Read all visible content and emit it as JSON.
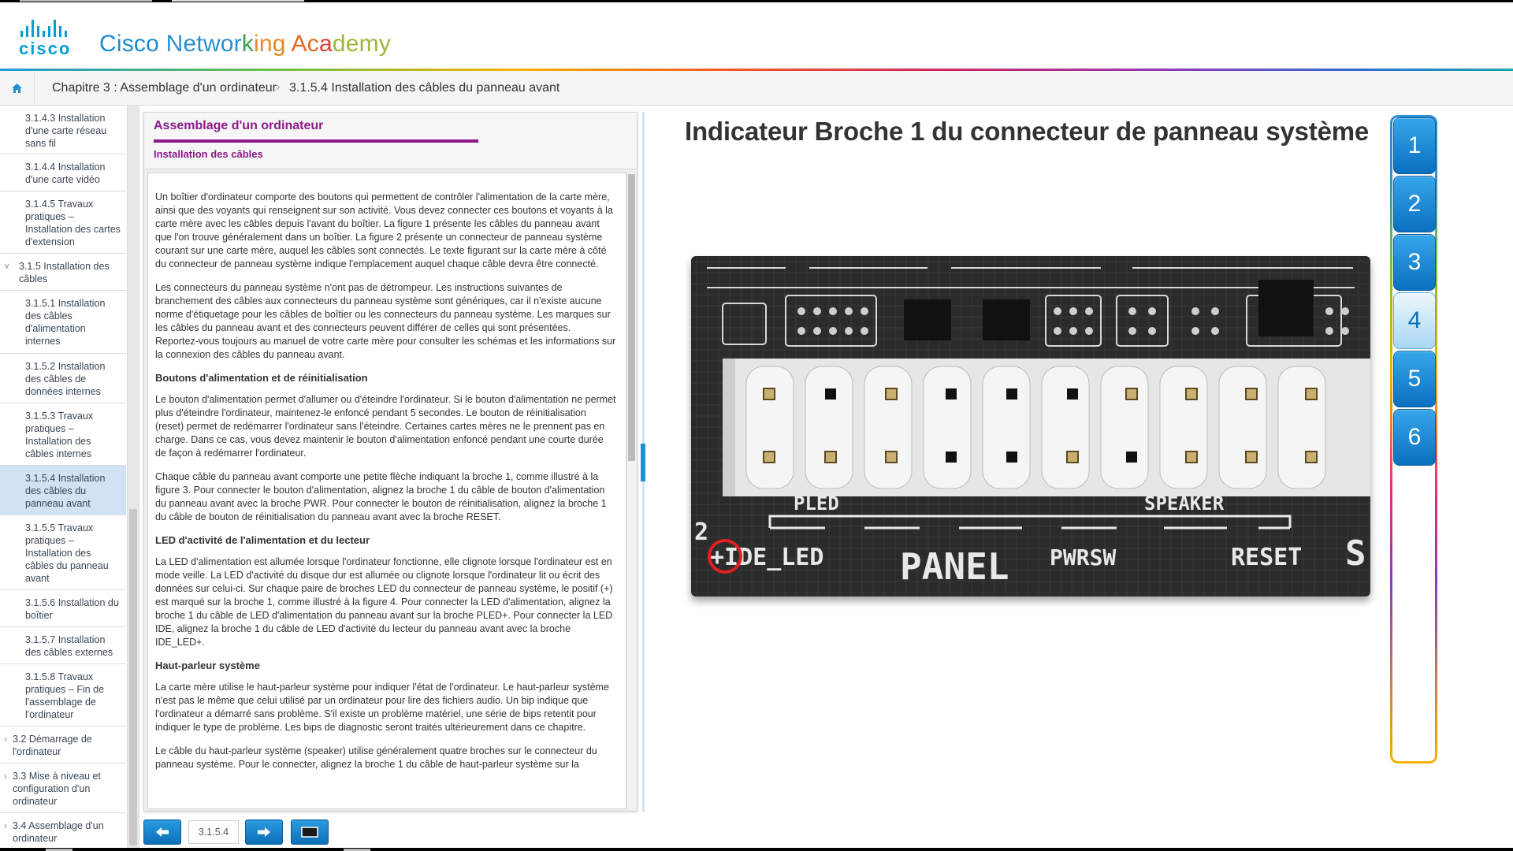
{
  "header": {
    "logo_text": "cisco",
    "title_parts": [
      {
        "text": "Cisco ",
        "color": "#1a8ccf"
      },
      {
        "text": "Networ",
        "color": "#2a8fd0"
      },
      {
        "text": "k",
        "color": "#3aa24a"
      },
      {
        "text": "ing ",
        "color": "#e58a1f"
      },
      {
        "text": "Ac",
        "color": "#e5681f"
      },
      {
        "text": "a",
        "color": "#d8413a"
      },
      {
        "text": "demy",
        "color": "#9cb83a"
      }
    ]
  },
  "breadcrumb": {
    "home_icon": "home-icon",
    "chapter": "Chapitre 3 : Assemblage d'un ordinateur",
    "separator": "›",
    "current": "3.1.5.4 Installation des câbles du panneau avant"
  },
  "sidebar": {
    "items": [
      {
        "label": "3.1.4.3 Installation d'une carte réseau sans fil",
        "level": 3,
        "active": false
      },
      {
        "label": "3.1.4.4 Installation d'une carte vidéo",
        "level": 3,
        "active": false
      },
      {
        "label": "3.1.4.5 Travaux pratiques – Installation des cartes d'extension",
        "level": 3,
        "active": false
      },
      {
        "label": "3.1.5 Installation des câbles",
        "level": 2,
        "active": false,
        "chevron": "chevron-down-icon"
      },
      {
        "label": "3.1.5.1 Installation des câbles d'alimentation internes",
        "level": 3,
        "active": false
      },
      {
        "label": "3.1.5.2 Installation des câbles de données internes",
        "level": 3,
        "active": false
      },
      {
        "label": "3.1.5.3 Travaux pratiques – Installation des câbles internes",
        "level": 3,
        "active": false
      },
      {
        "label": "3.1.5.4 Installation des câbles du panneau avant",
        "level": 3,
        "active": true
      },
      {
        "label": "3.1.5.5 Travaux pratiques – Installation des câbles du panneau avant",
        "level": 3,
        "active": false
      },
      {
        "label": "3.1.5.6 Installation du boîtier",
        "level": 3,
        "active": false
      },
      {
        "label": "3.1.5.7 Installation des câbles externes",
        "level": 3,
        "active": false
      },
      {
        "label": "3.1.5.8 Travaux pratiques – Fin de l'assemblage de l'ordinateur",
        "level": 3,
        "active": false
      },
      {
        "label": "3.2 Démarrage de l'ordinateur",
        "level": 1,
        "active": false,
        "chevron": "chevron-right-icon"
      },
      {
        "label": "3.3 Mise à niveau et configuration d'un ordinateur",
        "level": 1,
        "active": false,
        "chevron": "chevron-right-icon"
      },
      {
        "label": "3.4 Assemblage d'un ordinateur",
        "level": 1,
        "active": false,
        "chevron": "chevron-right-icon"
      }
    ]
  },
  "panel": {
    "title": "Assemblage d'un ordinateur",
    "subtitle": "Installation des câbles",
    "p1": "Un boîtier d'ordinateur comporte des boutons qui permettent de contrôler l'alimentation de la carte mère, ainsi que des voyants qui renseignent sur son activité. Vous devez connecter ces boutons et voyants à la carte mère avec les câbles depuis l'avant du boîtier. La figure 1 présente les câbles du panneau avant que l'on trouve généralement dans un boîtier. La figure 2 présente un connecteur de panneau système courant sur une carte mère, auquel les câbles sont connectés. Le texte figurant sur la carte mère à côté du connecteur de panneau système indique l'emplacement auquel chaque câble devra être connecté.",
    "p2": "Les connecteurs du panneau système n'ont pas de détrompeur. Les instructions suivantes de branchement des câbles aux connecteurs du panneau système sont génériques, car il n'existe aucune norme d'étiquetage pour les câbles de boîtier ou les connecteurs du panneau système. Les marques sur les câbles du panneau avant et des connecteurs peuvent différer de celles qui sont présentées. Reportez-vous toujours au manuel de votre carte mère pour consulter les schémas et les informations sur la connexion des câbles du panneau avant.",
    "h1": "Boutons d'alimentation et de réinitialisation",
    "p3": "Le bouton d'alimentation permet d'allumer ou d'éteindre l'ordinateur. Si le bouton d'alimentation ne permet plus d'éteindre l'ordinateur, maintenez-le enfoncé pendant 5 secondes. Le bouton de réinitialisation (reset) permet de redémarrer l'ordinateur sans l'éteindre. Certaines cartes mères ne le prennent pas en charge. Dans ce cas, vous devez maintenir le bouton d'alimentation enfoncé pendant une courte durée de façon à redémarrer l'ordinateur.",
    "p4": "Chaque câble du panneau avant comporte une petite flèche indiquant la broche 1, comme illustré à la figure 3. Pour connecter le bouton d'alimentation, alignez la broche 1 du câble de bouton d'alimentation du panneau avant avec la broche PWR. Pour connecter le bouton de réinitialisation, alignez la broche 1 du câble de bouton de réinitialisation du panneau avant avec la broche RESET.",
    "h2": "LED d'activité de l'alimentation et du lecteur",
    "p5": "La LED d'alimentation est allumée lorsque l'ordinateur fonctionne, elle clignote lorsque l'ordinateur est en mode veille. La LED d'activité du disque dur est allumée ou clignote lorsque l'ordinateur lit ou écrit des données sur celui-ci. Sur chaque paire de broches LED du connecteur de panneau système, le positif (+) est marqué sur la broche 1, comme illustré à la figure 4. Pour connecter la LED d'alimentation, alignez la broche 1 du câble de LED d'alimentation du panneau avant sur la broche PLED+. Pour connecter la LED IDE, alignez la broche 1 du câble de LED d'activité du lecteur du panneau avant avec la broche IDE_LED+.",
    "h3": "Haut-parleur système",
    "p6": "La carte mère utilise le haut-parleur système pour indiquer l'état de l'ordinateur. Le haut-parleur système n'est pas le même que celui utilisé par un ordinateur pour lire des fichiers audio. Un bip indique que l'ordinateur a démarré sans problème. S'il existe un problème matériel, une série de bips retentit pour indiquer le type de problème. Les bips de diagnostic seront traités ultérieurement dans ce chapitre.",
    "p7": "Le câble du haut-parleur système (speaker) utilise généralement quatre broches sur le connecteur du panneau système. Pour le connecter, alignez la broche 1 du câble de haut-parleur système sur la"
  },
  "bottom_nav": {
    "prev_icon": "arrow-left-icon",
    "page": "3.1.5.4",
    "next_icon": "arrow-right-icon",
    "screen_icon": "fullscreen-icon"
  },
  "figure": {
    "title": "Indicateur Broche 1 du connecteur de panneau système",
    "board_labels": {
      "pled": "PLED",
      "speaker": "SPEAKER",
      "pin2": "2",
      "ide_led": "+IDE_LED",
      "panel": "PANEL",
      "pwrsw": "PWRSW",
      "reset": "RESET",
      "s": "S"
    },
    "tabs": [
      "1",
      "2",
      "3",
      "4",
      "5",
      "6"
    ],
    "active_tab": "4"
  },
  "colors": {
    "accent_purple": "#8a1a8a",
    "cisco_blue": "#049fd9",
    "tab_blue": "#0a70c0",
    "active_nav": "#cfe3f5"
  }
}
